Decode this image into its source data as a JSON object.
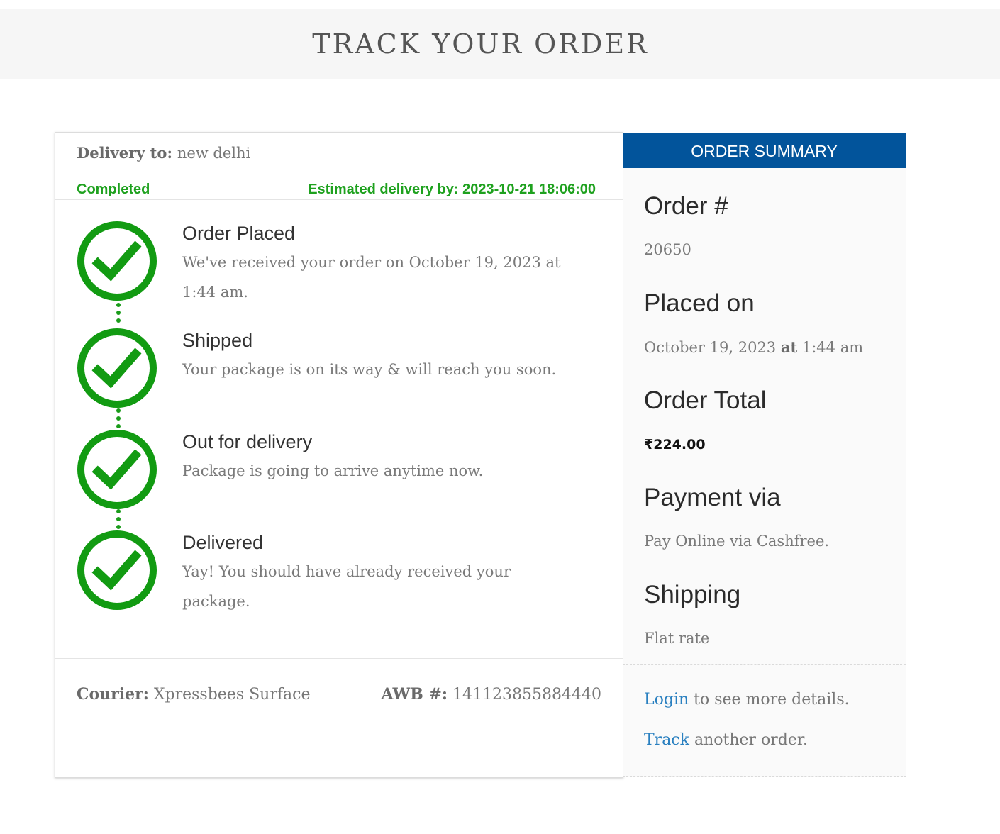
{
  "header": {
    "title": "TRACK YOUR ORDER"
  },
  "delivery": {
    "to_label": "Delivery to:",
    "to_value": "new delhi",
    "status": "Completed",
    "estimated": "Estimated delivery by: 2023-10-21 18:06:00",
    "status_color": "#1ea11e"
  },
  "steps": [
    {
      "title": "Order Placed",
      "desc": "We've received your order on October 19, 2023 at 1:44 am.",
      "icon": "check-circle-icon"
    },
    {
      "title": "Shipped",
      "desc": "Your package is on its way & will reach you soon.",
      "icon": "check-circle-icon"
    },
    {
      "title": "Out for delivery",
      "desc": "Package is going to arrive anytime now.",
      "icon": "check-circle-icon"
    },
    {
      "title": "Delivered",
      "desc": "Yay! You should have already received your package.",
      "icon": "check-circle-icon"
    }
  ],
  "courier": {
    "label": "Courier:",
    "value": "Xpressbees Surface",
    "awb_label": "AWB #:",
    "awb_value": "141123855884440"
  },
  "summary": {
    "heading": "ORDER SUMMARY",
    "heading_color": "#02549b",
    "order_label": "Order #",
    "order_value": "20650",
    "placed_label": "Placed on",
    "placed_date": "October 19, 2023",
    "placed_at": "at",
    "placed_time": "1:44 am",
    "total_label": "Order Total",
    "total_value": "₹224.00",
    "payment_label": "Payment via",
    "payment_value": "Pay Online via Cashfree.",
    "shipping_label": "Shipping",
    "shipping_value": "Flat rate",
    "login_link": "Login",
    "login_rest": " to see more details.",
    "track_link": "Track",
    "track_rest": " another order."
  }
}
